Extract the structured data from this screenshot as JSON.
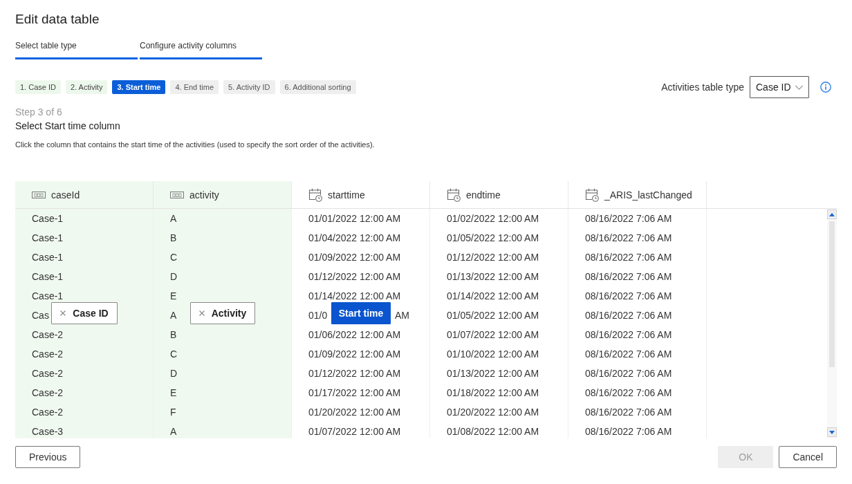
{
  "dialog": {
    "title": "Edit data table"
  },
  "wizard_tabs": [
    {
      "label": "Select table type",
      "active": true
    },
    {
      "label": "Configure activity columns",
      "active": true
    }
  ],
  "steps": [
    {
      "label": "1. Case ID",
      "done": true,
      "selected": false
    },
    {
      "label": "2. Activity",
      "done": true,
      "selected": false
    },
    {
      "label": "3. Start time",
      "done": false,
      "selected": true
    },
    {
      "label": "4. End time",
      "done": false,
      "selected": false
    },
    {
      "label": "5. Activity ID",
      "done": false,
      "selected": false
    },
    {
      "label": "6. Additional sorting",
      "done": false,
      "selected": false
    }
  ],
  "table_type": {
    "label": "Activities table type",
    "value": "Case ID"
  },
  "step_info": {
    "counter": "Step 3 of 6",
    "heading": "Select Start time column",
    "description": "Click the column that contains the start time of the activities (used to specify the sort order of the activities)."
  },
  "table": {
    "columns": [
      {
        "name": "caseId",
        "kind": "text",
        "assigned": true
      },
      {
        "name": "activity",
        "kind": "text",
        "assigned": true
      },
      {
        "name": "starttime",
        "kind": "datetime",
        "assigned": false
      },
      {
        "name": "endtime",
        "kind": "datetime",
        "assigned": false
      },
      {
        "name": "_ARIS_lastChanged",
        "kind": "datetime",
        "assigned": false
      }
    ],
    "rows": [
      [
        "Case-1",
        "A",
        "01/01/2022 12:00 AM",
        "01/02/2022 12:00 AM",
        "08/16/2022 7:06 AM"
      ],
      [
        "Case-1",
        "B",
        "01/04/2022 12:00 AM",
        "01/05/2022 12:00 AM",
        "08/16/2022 7:06 AM"
      ],
      [
        "Case-1",
        "C",
        "01/09/2022 12:00 AM",
        "01/12/2022 12:00 AM",
        "08/16/2022 7:06 AM"
      ],
      [
        "Case-1",
        "D",
        "01/12/2022 12:00 AM",
        "01/13/2022 12:00 AM",
        "08/16/2022 7:06 AM"
      ],
      [
        "Case-1",
        "E",
        "01/14/2022 12:00 AM",
        "01/14/2022 12:00 AM",
        "08/16/2022 7:06 AM"
      ],
      [
        "Cas",
        "A",
        [
          "01/0",
          "AM"
        ],
        "01/05/2022 12:00 AM",
        "08/16/2022 7:06 AM"
      ],
      [
        "Case-2",
        "B",
        "01/06/2022 12:00 AM",
        "01/07/2022 12:00 AM",
        "08/16/2022 7:06 AM"
      ],
      [
        "Case-2",
        "C",
        "01/09/2022 12:00 AM",
        "01/10/2022 12:00 AM",
        "08/16/2022 7:06 AM"
      ],
      [
        "Case-2",
        "D",
        "01/12/2022 12:00 AM",
        "01/13/2022 12:00 AM",
        "08/16/2022 7:06 AM"
      ],
      [
        "Case-2",
        "E",
        "01/17/2022 12:00 AM",
        "01/18/2022 12:00 AM",
        "08/16/2022 7:06 AM"
      ],
      [
        "Case-2",
        "F",
        "01/20/2022 12:00 AM",
        "01/20/2022 12:00 AM",
        "08/16/2022 7:06 AM"
      ],
      [
        "Case-3",
        "A",
        "01/07/2022 12:00 AM",
        "01/08/2022 12:00 AM",
        "08/16/2022 7:06 AM"
      ]
    ],
    "mapping_tags": [
      {
        "label": "Case ID",
        "selected": false
      },
      {
        "label": "Activity",
        "selected": false
      },
      {
        "label": "Start time",
        "selected": true
      }
    ]
  },
  "footer": {
    "left_buttons": [
      {
        "label": "Previous",
        "disabled": false
      }
    ],
    "right_buttons": [
      {
        "label": "OK",
        "disabled": true
      },
      {
        "label": "Cancel",
        "disabled": false
      }
    ]
  }
}
